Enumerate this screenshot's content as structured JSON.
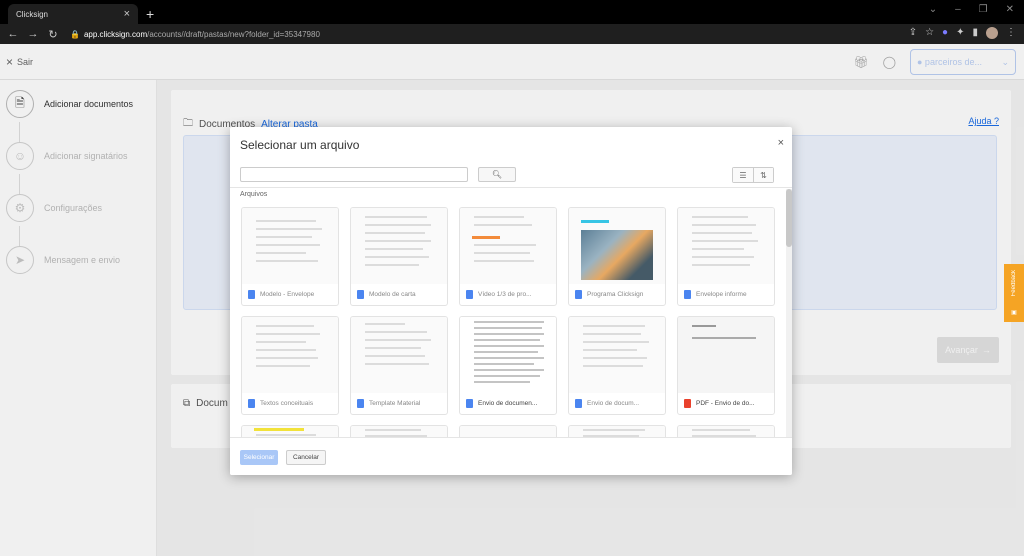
{
  "browser": {
    "tab_title": "Clicksign",
    "url_host": "app.clicksign.com",
    "url_path": "/accounts/",
    "url_rest": "/draft/pastas/new?folder_id=35347980",
    "new_tab_symbol": "+",
    "tab_close_symbol": "×"
  },
  "app_header": {
    "exit_label": "Sair",
    "account_label": "● parceiros de..."
  },
  "sidebar": {
    "steps": [
      {
        "label": "Adicionar documentos",
        "icon": "document-add-icon",
        "active": true
      },
      {
        "label": "Adicionar signatários",
        "icon": "users-icon",
        "active": false
      },
      {
        "label": "Configurações",
        "icon": "gear-icon",
        "active": false
      },
      {
        "label": "Mensagem e envio",
        "icon": "send-icon",
        "active": false
      }
    ]
  },
  "main": {
    "documents_title": "Documentos",
    "change_folder_link": "Alterar pasta",
    "help_link": "Ajuda",
    "advance_button": "Avançar",
    "second_card_title": "Docum"
  },
  "modal": {
    "title": "Selecionar um arquivo",
    "close_symbol": "×",
    "search_placeholder": "",
    "section_label": "Arquivos",
    "files": [
      {
        "name": "Modelo - Envelope",
        "type": "doc"
      },
      {
        "name": "Modelo de carta",
        "type": "doc"
      },
      {
        "name": "Vídeo 1/3 de pro...",
        "type": "doc"
      },
      {
        "name": "Programa Clicksign",
        "type": "doc"
      },
      {
        "name": "Envelope informe",
        "type": "doc"
      },
      {
        "name": "Textos conceituais",
        "type": "doc"
      },
      {
        "name": "Template Material",
        "type": "doc"
      },
      {
        "name": "Envio de documen...",
        "type": "doc"
      },
      {
        "name": "Envio de docum...",
        "type": "doc"
      },
      {
        "name": "PDF - Envio de do...",
        "type": "pdf"
      }
    ],
    "select_button": "Selecionar",
    "cancel_button": "Cancelar"
  },
  "feedback_label": "Feedback",
  "colors": {
    "primary": "#1b6ee9",
    "feedback": "#f5a424",
    "dropzone": "#eef4fe"
  }
}
